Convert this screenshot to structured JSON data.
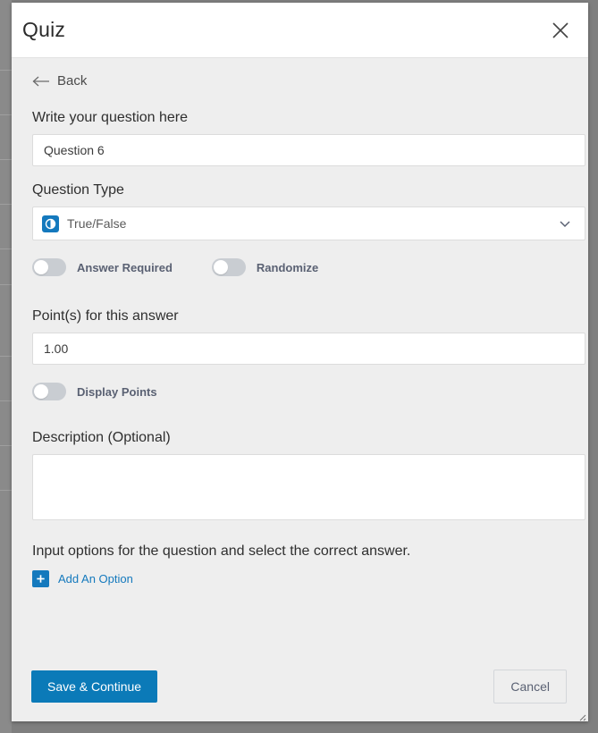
{
  "window": {
    "title": "Quiz",
    "close_icon": "close-x-icon"
  },
  "nav": {
    "back_label": "Back",
    "back_icon": "arrow-left-icon"
  },
  "form": {
    "question_label": "Write your question here",
    "question_value": "Question 6",
    "question_placeholder": "",
    "question_type_label": "Question Type",
    "question_type_value": "True/False",
    "question_type_icon": "true-false-icon",
    "chevron_icon": "chevron-down-icon",
    "toggles": [
      {
        "label": "Answer Required",
        "on": false
      },
      {
        "label": "Randomize",
        "on": false
      }
    ],
    "points_label": "Point(s) for this answer",
    "points_value": "1.00",
    "display_points_toggle": {
      "label": "Display Points",
      "on": false
    },
    "description_label": "Description (Optional)",
    "description_value": "",
    "description_placeholder": ""
  },
  "options": {
    "hint": "Input options for the question and select the correct answer.",
    "add_label": "Add An Option",
    "add_icon": "plus-icon"
  },
  "footer": {
    "save_label": "Save & Continue",
    "cancel_label": "Cancel"
  },
  "colors": {
    "accent_blue": "#1479bd",
    "primary_button": "#0b7ab8",
    "panel_bg": "#eeeeee",
    "backdrop": "#7f7f7f",
    "toggle_off": "#c9cdd2"
  }
}
